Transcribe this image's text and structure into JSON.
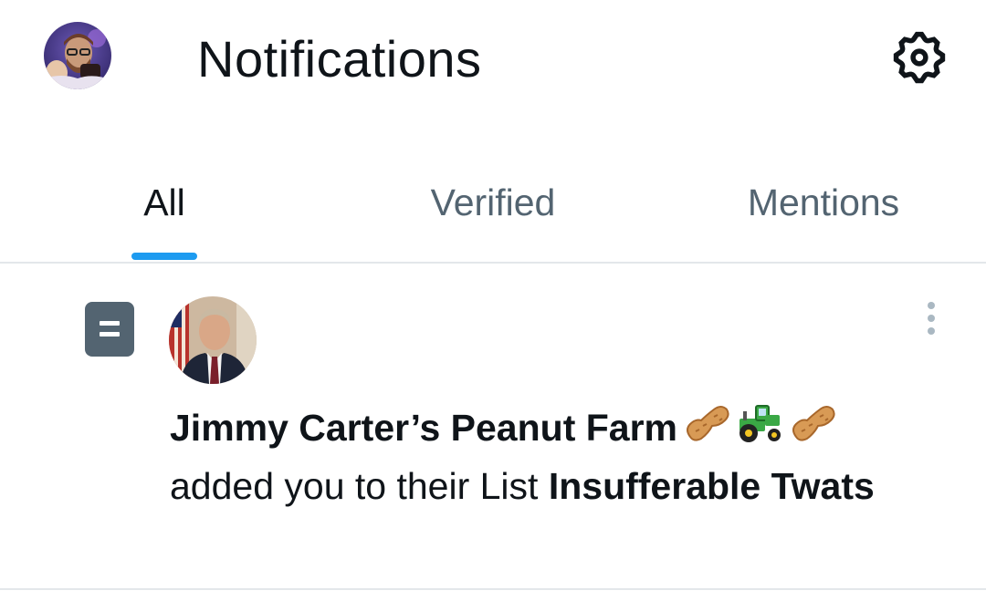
{
  "header": {
    "title": "Notifications",
    "avatar_icon": "user-avatar",
    "settings_icon": "gear-icon"
  },
  "tabs": [
    {
      "label": "All",
      "active": true
    },
    {
      "label": "Verified",
      "active": false
    },
    {
      "label": "Mentions",
      "active": false
    }
  ],
  "notification": {
    "type_icon": "list-icon",
    "account_name": "Jimmy Carter’s Peanut Farm",
    "emojis": [
      "peanut-emoji",
      "tractor-emoji",
      "peanut-emoji"
    ],
    "action_text": "added you to their List",
    "list_name": "Insufferable Twats",
    "more_icon": "more-vertical-icon"
  },
  "colors": {
    "accent": "#1d9bf0",
    "text_primary": "#0f1419",
    "text_secondary": "#536471",
    "divider": "#e3e7ea"
  }
}
